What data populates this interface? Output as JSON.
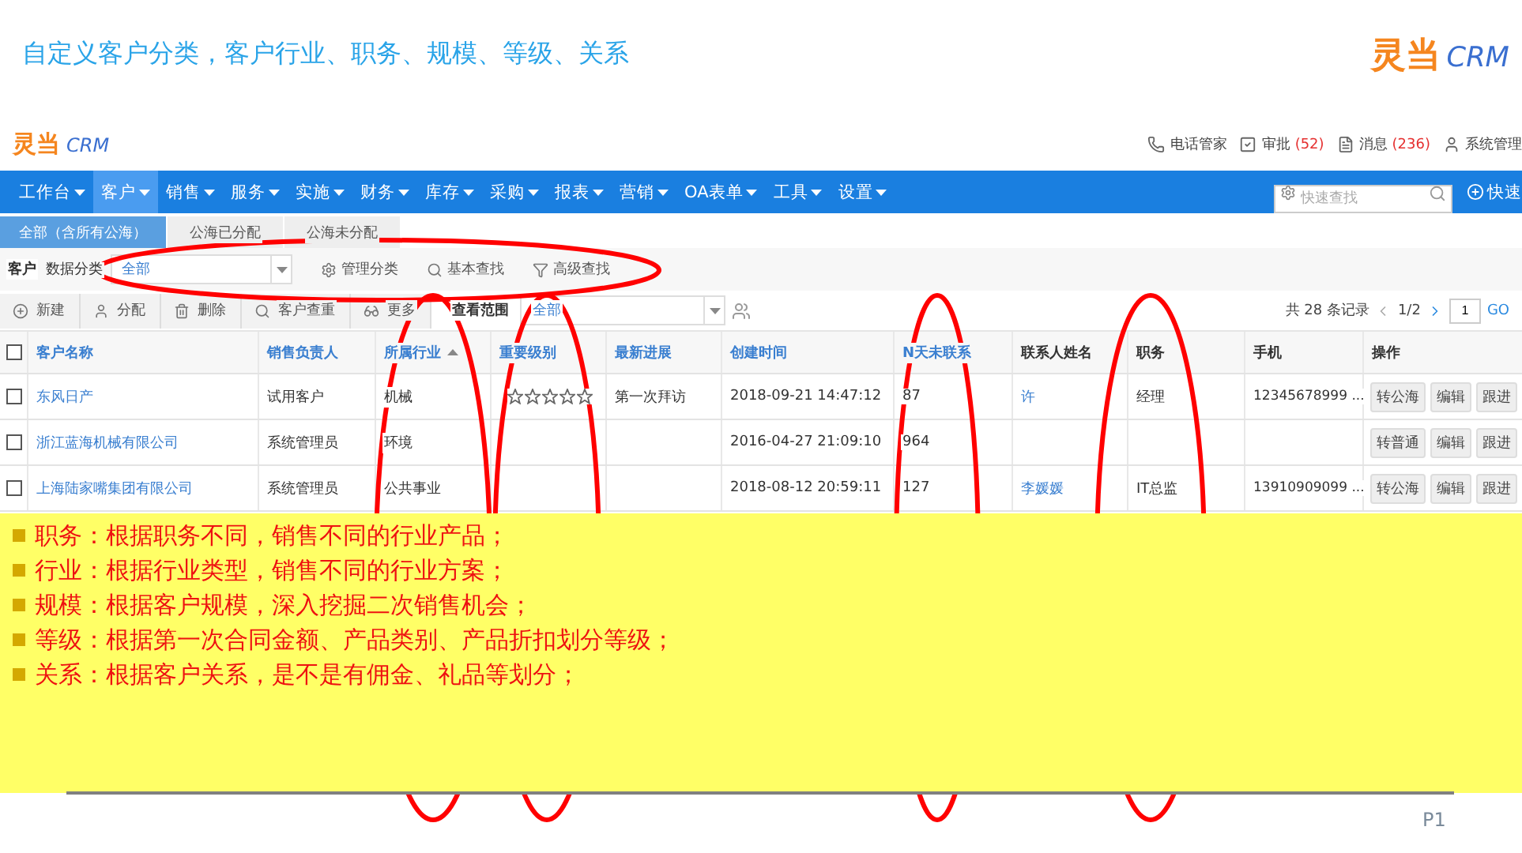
{
  "slide": {
    "title": "自定义客户分类，客户行业、职务、规模、等级、关系",
    "logo": {
      "mark": "灵当",
      "text": "CRM"
    },
    "page_number": "P1"
  },
  "app": {
    "logo": {
      "mark": "灵当",
      "text": "CRM"
    },
    "top_links": [
      {
        "kind": "phone",
        "label": "电话管家"
      },
      {
        "kind": "approve",
        "label": "审批",
        "count": "(52)"
      },
      {
        "kind": "message",
        "label": "消息",
        "count": "(236)"
      },
      {
        "kind": "user",
        "label": "系统管理"
      }
    ],
    "nav": [
      {
        "label": "工作台",
        "selected": false
      },
      {
        "label": "客户",
        "selected": true
      },
      {
        "label": "销售",
        "selected": false
      },
      {
        "label": "服务",
        "selected": false
      },
      {
        "label": "实施",
        "selected": false
      },
      {
        "label": "财务",
        "selected": false
      },
      {
        "label": "库存",
        "selected": false
      },
      {
        "label": "采购",
        "selected": false
      },
      {
        "label": "报表",
        "selected": false
      },
      {
        "label": "营销",
        "selected": false
      },
      {
        "label": "OA表单",
        "selected": false
      },
      {
        "label": "工具",
        "selected": false
      },
      {
        "label": "设置",
        "selected": false
      }
    ],
    "quick_search": {
      "placeholder": "快速查找"
    },
    "quick_add": "快速",
    "tabs": [
      {
        "label": "全部（含所有公海）",
        "selected": true
      },
      {
        "label": "公海已分配",
        "selected": false
      },
      {
        "label": "公海未分配",
        "selected": false
      }
    ],
    "filter": {
      "module": "客户",
      "label": "数据分类",
      "value": "全部",
      "actions": [
        {
          "kind": "gear",
          "label": "管理分类"
        },
        {
          "kind": "search",
          "label": "基本查找"
        },
        {
          "kind": "filter",
          "label": "高级查找"
        }
      ]
    },
    "toolbar": [
      {
        "kind": "plus",
        "label": "新建"
      },
      {
        "kind": "user",
        "label": "分配"
      },
      {
        "kind": "trash",
        "label": "删除"
      },
      {
        "kind": "search",
        "label": "客户查重"
      },
      {
        "kind": "more",
        "label": "更多"
      }
    ],
    "scope": {
      "label": "查看范围",
      "value": "全部"
    },
    "pagination": {
      "total": "共 28 条记录",
      "page": "1/2",
      "input": "1",
      "go": "GO"
    },
    "table": {
      "select_all": {
        "checked": false
      },
      "columns": [
        {
          "label": "客户名称",
          "sortable": true,
          "sorted": false
        },
        {
          "label": "销售负责人",
          "sortable": true,
          "sorted": false
        },
        {
          "label": "所属行业",
          "sortable": true,
          "sorted": true
        },
        {
          "label": "重要级别",
          "sortable": true,
          "sorted": false
        },
        {
          "label": "最新进展",
          "sortable": true,
          "sorted": false
        },
        {
          "label": "创建时间",
          "sortable": true,
          "sorted": false
        },
        {
          "label": "N天未联系",
          "sortable": true,
          "sorted": false
        },
        {
          "label": "联系人姓名",
          "sortable": false,
          "sorted": false
        },
        {
          "label": "职务",
          "sortable": false,
          "sorted": false
        },
        {
          "label": "手机",
          "sortable": false,
          "sorted": false
        },
        {
          "label": "操作",
          "sortable": false,
          "sorted": false
        }
      ],
      "rows": [
        {
          "checked": false,
          "name": "东风日产",
          "owner": "试用客户",
          "industry": "机械",
          "stars": 0,
          "progress": "第一次拜访",
          "created": "2018-09-21 14:47:12",
          "days": "87",
          "contact": "许",
          "title": "经理",
          "mobile": "12345678999 ...",
          "actions": [
            "转公海",
            "编辑",
            "跟进"
          ]
        },
        {
          "checked": false,
          "name": "浙江蓝海机械有限公司",
          "owner": "系统管理员",
          "industry": "环境",
          "created": "2016-04-27 21:09:10",
          "days": "964",
          "actions": [
            "转普通",
            "编辑",
            "跟进"
          ]
        },
        {
          "checked": false,
          "name": "上海陆家嘴集团有限公司",
          "owner": "系统管理员",
          "industry": "公共事业",
          "created": "2018-08-12 20:59:11",
          "days": "127",
          "contact": "李媛媛",
          "title": "IT总监",
          "mobile": "13910909099 ...",
          "actions": [
            "转公海",
            "编辑",
            "跟进"
          ]
        }
      ]
    }
  },
  "notes": [
    "职务：根据职务不同，销售不同的行业产品；",
    "行业：根据行业类型，销售不同的行业方案；",
    "规模：根据客户规模，深入挖掘二次销售机会；",
    "等级：根据第一次合同金额、产品类别、产品折扣划分等级；",
    "关系：根据客户关系，是不是有佣金、礼品等划分；"
  ]
}
